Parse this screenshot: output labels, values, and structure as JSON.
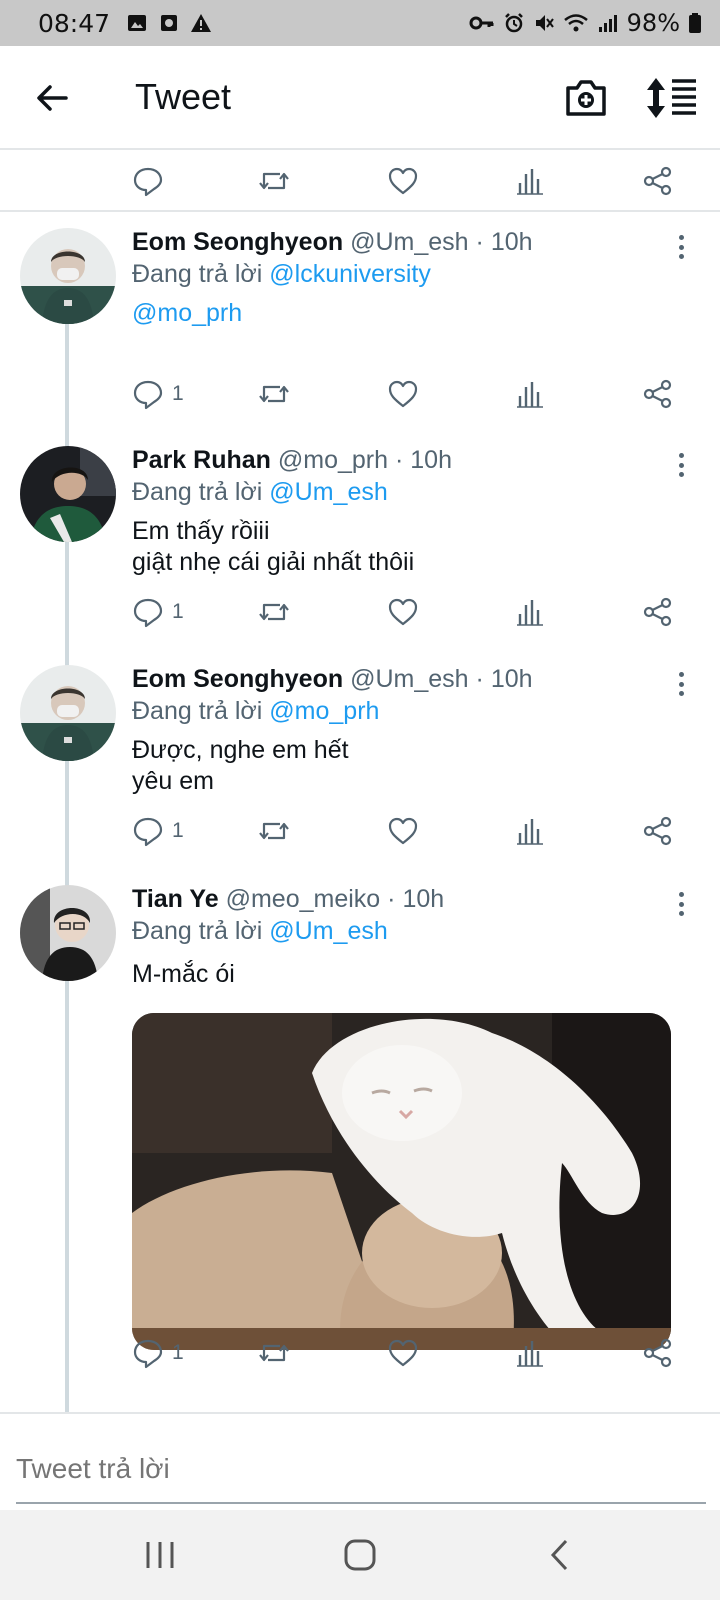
{
  "status_bar": {
    "time": "08:47",
    "battery": "98%"
  },
  "header": {
    "title": "Tweet"
  },
  "tweets": [
    {
      "name": "Eom Seonghyeon",
      "handle": "@Um_esh",
      "time": "10h",
      "reply_prefix": "Đang trả lời",
      "reply_to": "@lckuniversity",
      "body_line1": "@mo_prh",
      "reply_count": "1"
    },
    {
      "name": "Park Ruhan",
      "handle": "@mo_prh",
      "time": "10h",
      "reply_prefix": "Đang trả lời",
      "reply_to": "@Um_esh",
      "body_line1": "Em thấy rồiii",
      "body_line2": "giật nhẹ cái giải nhất thôii",
      "reply_count": "1"
    },
    {
      "name": "Eom Seonghyeon",
      "handle": "@Um_esh",
      "time": "10h",
      "reply_prefix": "Đang trả lời",
      "reply_to": "@mo_prh",
      "body_line1": "Được, nghe em hết",
      "body_line2": "yêu em",
      "reply_count": "1"
    },
    {
      "name": "Tian Ye",
      "handle": "@meo_meiko",
      "time": "10h",
      "reply_prefix": "Đang trả lời",
      "reply_to": "@Um_esh",
      "body_line1": "M-mắc ói",
      "reply_count": "1"
    }
  ],
  "separator": "·",
  "composer": {
    "placeholder": "Tweet trả lời"
  },
  "colors": {
    "link": "#1d9bf0",
    "secondary": "#536471"
  }
}
